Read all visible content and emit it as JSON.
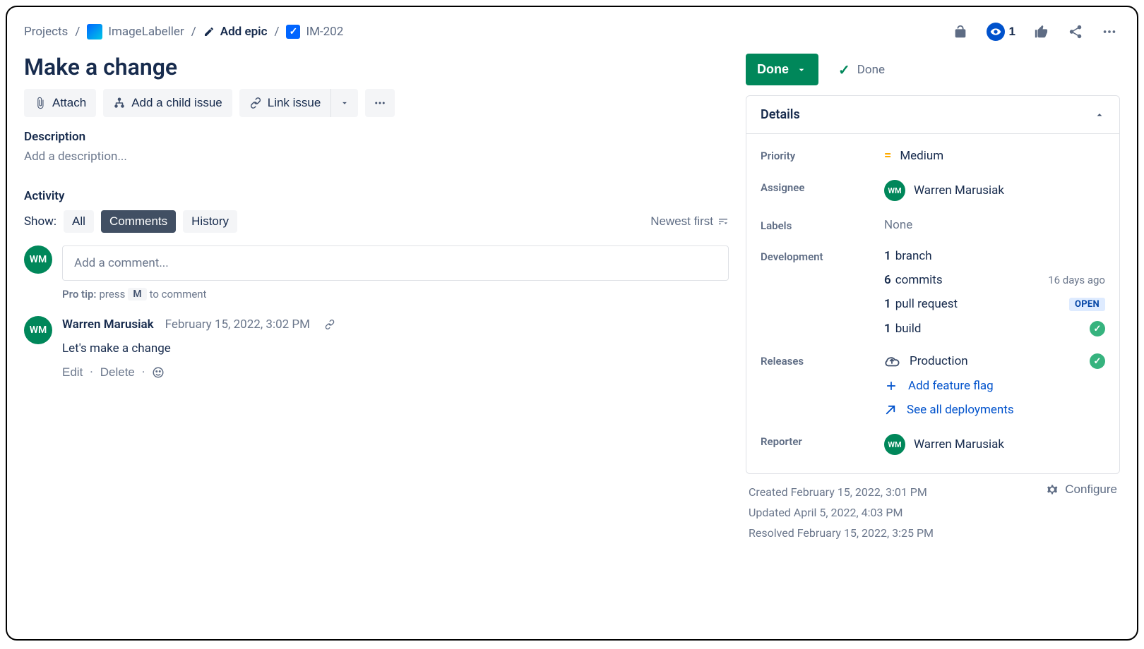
{
  "breadcrumbs": {
    "projects": "Projects",
    "project_name": "ImageLabeller",
    "add_epic": "Add epic",
    "issue_key": "IM-202"
  },
  "top_actions": {
    "watch_count": "1"
  },
  "issue": {
    "title": "Make a change",
    "description_label": "Description",
    "description_placeholder": "Add a description..."
  },
  "toolbar": {
    "attach": "Attach",
    "child": "Add a child issue",
    "link": "Link issue"
  },
  "activity": {
    "header": "Activity",
    "show_label": "Show:",
    "tab_all": "All",
    "tab_comments": "Comments",
    "tab_history": "History",
    "sort": "Newest first"
  },
  "comment_input": {
    "placeholder": "Add a comment...",
    "protip_label": "Pro tip:",
    "protip_pre": "press",
    "protip_key": "M",
    "protip_post": "to comment"
  },
  "comments": [
    {
      "author": "Warren Marusiak",
      "avatar_initials": "WM",
      "time": "February 15, 2022, 3:02 PM",
      "body": "Let's make a change",
      "edit": "Edit",
      "delete": "Delete"
    }
  ],
  "status": {
    "button": "Done",
    "label": "Done"
  },
  "details": {
    "header": "Details",
    "priority_label": "Priority",
    "priority_value": "Medium",
    "assignee_label": "Assignee",
    "assignee_value": "Warren Marusiak",
    "assignee_initials": "WM",
    "labels_label": "Labels",
    "labels_value": "None",
    "development_label": "Development",
    "dev_branch_count": "1",
    "dev_branch_text": "branch",
    "dev_commits_count": "6",
    "dev_commits_text": "commits",
    "dev_commits_age": "16 days ago",
    "dev_pr_count": "1",
    "dev_pr_text": "pull request",
    "dev_pr_badge": "OPEN",
    "dev_build_count": "1",
    "dev_build_text": "build",
    "releases_label": "Releases",
    "release_env": "Production",
    "add_feature_flag": "Add feature flag",
    "see_all": "See all deployments",
    "reporter_label": "Reporter",
    "reporter_value": "Warren Marusiak",
    "reporter_initials": "WM"
  },
  "timestamps": {
    "created": "Created February 15, 2022, 3:01 PM",
    "updated": "Updated April 5, 2022, 4:03 PM",
    "resolved": "Resolved February 15, 2022, 3:25 PM"
  },
  "configure": "Configure",
  "current_user_initials": "WM"
}
